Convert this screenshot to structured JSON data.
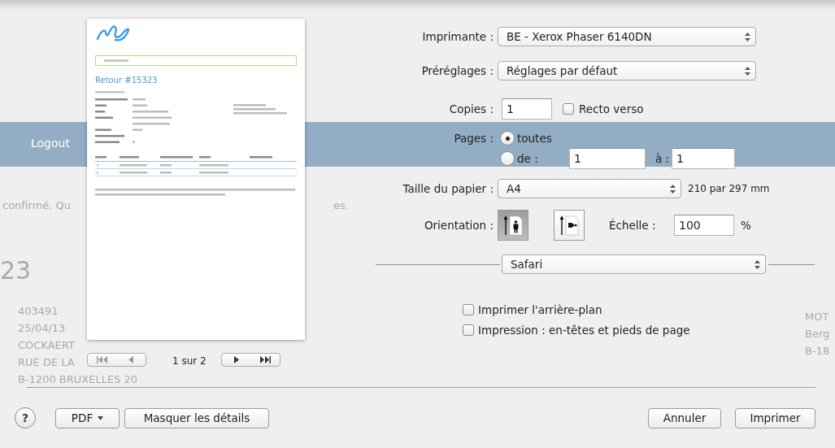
{
  "background_page": {
    "nav_button": "Logout",
    "notice_start": "confirmé. Qu",
    "notice_end": "es.",
    "heading": "23",
    "lines": [
      "403491",
      "25/04/13",
      "COCKAERT",
      "RUE DE LA",
      "B-1200 BRUXELLES 20"
    ],
    "address_lines": [
      "MOT",
      "Berg",
      "B-18"
    ]
  },
  "preview": {
    "title": "Retour #15323",
    "page_indicator": "1 sur 2"
  },
  "form": {
    "printer": {
      "label": "Imprimante :",
      "value": "BE - Xerox Phaser 6140DN"
    },
    "presets": {
      "label": "Préréglages :",
      "value": "Réglages par défaut"
    },
    "copies": {
      "label": "Copies :",
      "value": "1"
    },
    "duplex": {
      "label": "Recto verso",
      "checked": false
    },
    "pages": {
      "label": "Pages :",
      "options": [
        {
          "label": "toutes",
          "selected": true
        },
        {
          "label": "de :",
          "selected": false
        }
      ],
      "from": "1",
      "to_label": "à :",
      "to": "1"
    },
    "paper": {
      "label": "Taille du papier :",
      "value": "A4",
      "dimensions": "210 par 297 mm"
    },
    "orientation": {
      "label": "Orientation :",
      "options": [
        {
          "kind": "portrait",
          "selected": true
        },
        {
          "kind": "landscape",
          "selected": false
        }
      ]
    },
    "scale": {
      "label": "Échelle :",
      "value": "100",
      "unit": "%"
    },
    "section": "Safari",
    "options": [
      {
        "label": "Imprimer l'arrière-plan",
        "checked": false
      },
      {
        "label": "Impression : en-têtes et pieds de page",
        "checked": false
      }
    ]
  },
  "footer": {
    "help": "?",
    "pdf": "PDF",
    "details": "Masquer les détails",
    "cancel": "Annuler",
    "print": "Imprimer"
  }
}
